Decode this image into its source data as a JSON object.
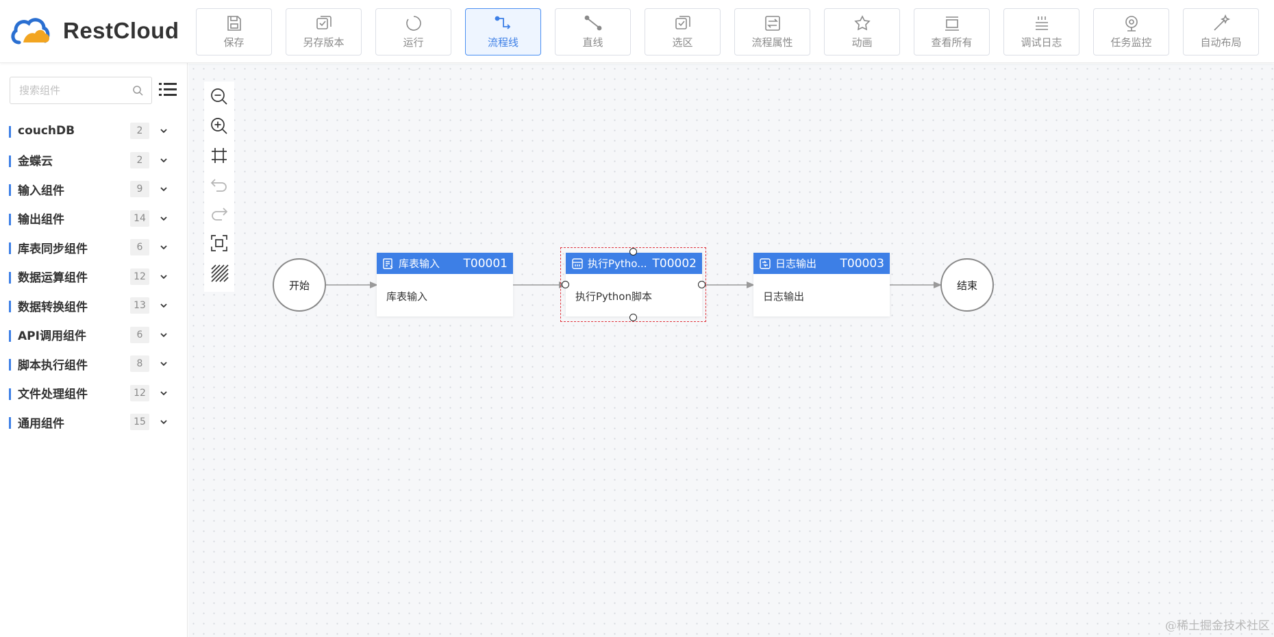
{
  "brand": {
    "name": "RestCloud"
  },
  "toolbar": [
    {
      "label": "保存",
      "icon": "save-icon",
      "active": false
    },
    {
      "label": "另存版本",
      "icon": "save-version-icon",
      "active": false
    },
    {
      "label": "运行",
      "icon": "run-icon",
      "active": false
    },
    {
      "label": "流程线",
      "icon": "flow-line-icon",
      "active": true
    },
    {
      "label": "直线",
      "icon": "straight-line-icon",
      "active": false
    },
    {
      "label": "选区",
      "icon": "selection-icon",
      "active": false
    },
    {
      "label": "流程属性",
      "icon": "flow-properties-icon",
      "active": false
    },
    {
      "label": "动画",
      "icon": "animation-icon",
      "active": false
    },
    {
      "label": "查看所有",
      "icon": "view-all-icon",
      "active": false
    },
    {
      "label": "调试日志",
      "icon": "debug-log-icon",
      "active": false
    },
    {
      "label": "任务监控",
      "icon": "task-monitor-icon",
      "active": false
    },
    {
      "label": "自动布局",
      "icon": "auto-layout-icon",
      "active": false
    }
  ],
  "sidebar": {
    "search": {
      "placeholder": "搜索组件",
      "value": ""
    },
    "groups": [
      {
        "label": "couchDB",
        "count": "2"
      },
      {
        "label": "金蝶云",
        "count": "2"
      },
      {
        "label": "输入组件",
        "count": "9"
      },
      {
        "label": "输出组件",
        "count": "14"
      },
      {
        "label": "库表同步组件",
        "count": "6"
      },
      {
        "label": "数据运算组件",
        "count": "12"
      },
      {
        "label": "数据转换组件",
        "count": "13"
      },
      {
        "label": "API调用组件",
        "count": "6"
      },
      {
        "label": "脚本执行组件",
        "count": "8"
      },
      {
        "label": "文件处理组件",
        "count": "12"
      },
      {
        "label": "通用组件",
        "count": "15"
      }
    ]
  },
  "canvas_tools": [
    "zoom-out-icon",
    "zoom-in-icon",
    "fit-view-icon",
    "undo-icon",
    "redo-icon",
    "actual-size-icon",
    "grid-toggle-icon"
  ],
  "flow": {
    "start": {
      "label": "开始"
    },
    "end": {
      "label": "结束"
    },
    "tasks": [
      {
        "name": "库表输入",
        "id": "T00001",
        "body": "库表输入",
        "icon": "table-input-icon",
        "selected": false
      },
      {
        "name": "执行Pytho...",
        "id": "T00002",
        "body": "执行Python脚本",
        "icon": "python-script-icon",
        "selected": true
      },
      {
        "name": "日志输出",
        "id": "T00003",
        "body": "日志输出",
        "icon": "log-output-icon",
        "selected": false
      }
    ]
  },
  "colors": {
    "accent": "#3d7fe6",
    "selection": "#e0333b",
    "canvas": "#f6f7f9"
  },
  "watermark": "@稀土掘金技术社区"
}
